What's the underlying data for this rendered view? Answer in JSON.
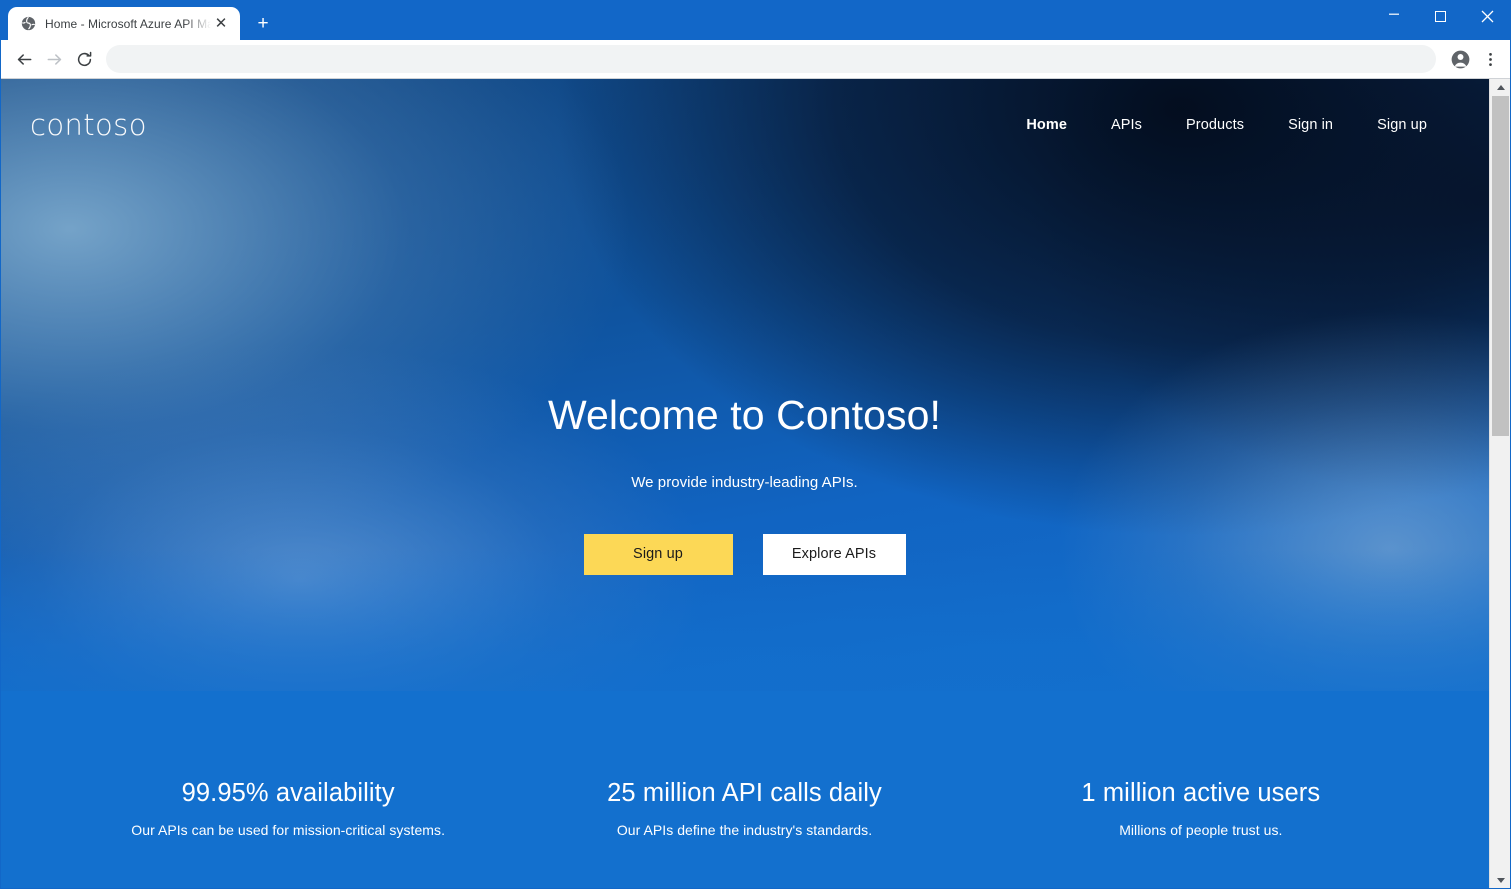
{
  "browser": {
    "tab": {
      "favicon": "globe-icon",
      "title": "Home - Microsoft Azure API Man",
      "close_label": "✕"
    },
    "new_tab_label": "+",
    "window_controls": {
      "minimize": "–",
      "maximize": "maximize-icon",
      "close": "✕"
    },
    "toolbar": {
      "back_icon": "back-arrow-icon",
      "forward_icon": "forward-arrow-icon",
      "reload_icon": "reload-icon",
      "address_value": "",
      "address_placeholder": "",
      "profile_icon": "profile-avatar-icon",
      "menu_icon": "three-dot-menu-icon"
    }
  },
  "site": {
    "brand": "contoso",
    "nav": [
      {
        "label": "Home",
        "active": true
      },
      {
        "label": "APIs",
        "active": false
      },
      {
        "label": "Products",
        "active": false
      },
      {
        "label": "Sign in",
        "active": false
      },
      {
        "label": "Sign up",
        "active": false
      }
    ],
    "hero": {
      "title": "Welcome to Contoso!",
      "subtitle": "We provide industry-leading APIs.",
      "primary_cta": "Sign up",
      "secondary_cta": "Explore APIs"
    },
    "stats": [
      {
        "value": "99.95% availability",
        "desc": "Our APIs can be used for mission-critical systems."
      },
      {
        "value": "25 million API calls daily",
        "desc": "Our APIs define the industry's standards."
      },
      {
        "value": "1 million active users",
        "desc": "Millions of people trust us."
      }
    ]
  },
  "colors": {
    "chrome_blue": "#1267c8",
    "accent_yellow": "#fcd856",
    "band_blue": "#1370ce",
    "hero_dark": "#0a1b33",
    "hero_light": "#5b9bc9"
  },
  "scrollbar": {
    "up_arrow": "scroll-up-icon",
    "down_arrow": "scroll-down-icon"
  }
}
